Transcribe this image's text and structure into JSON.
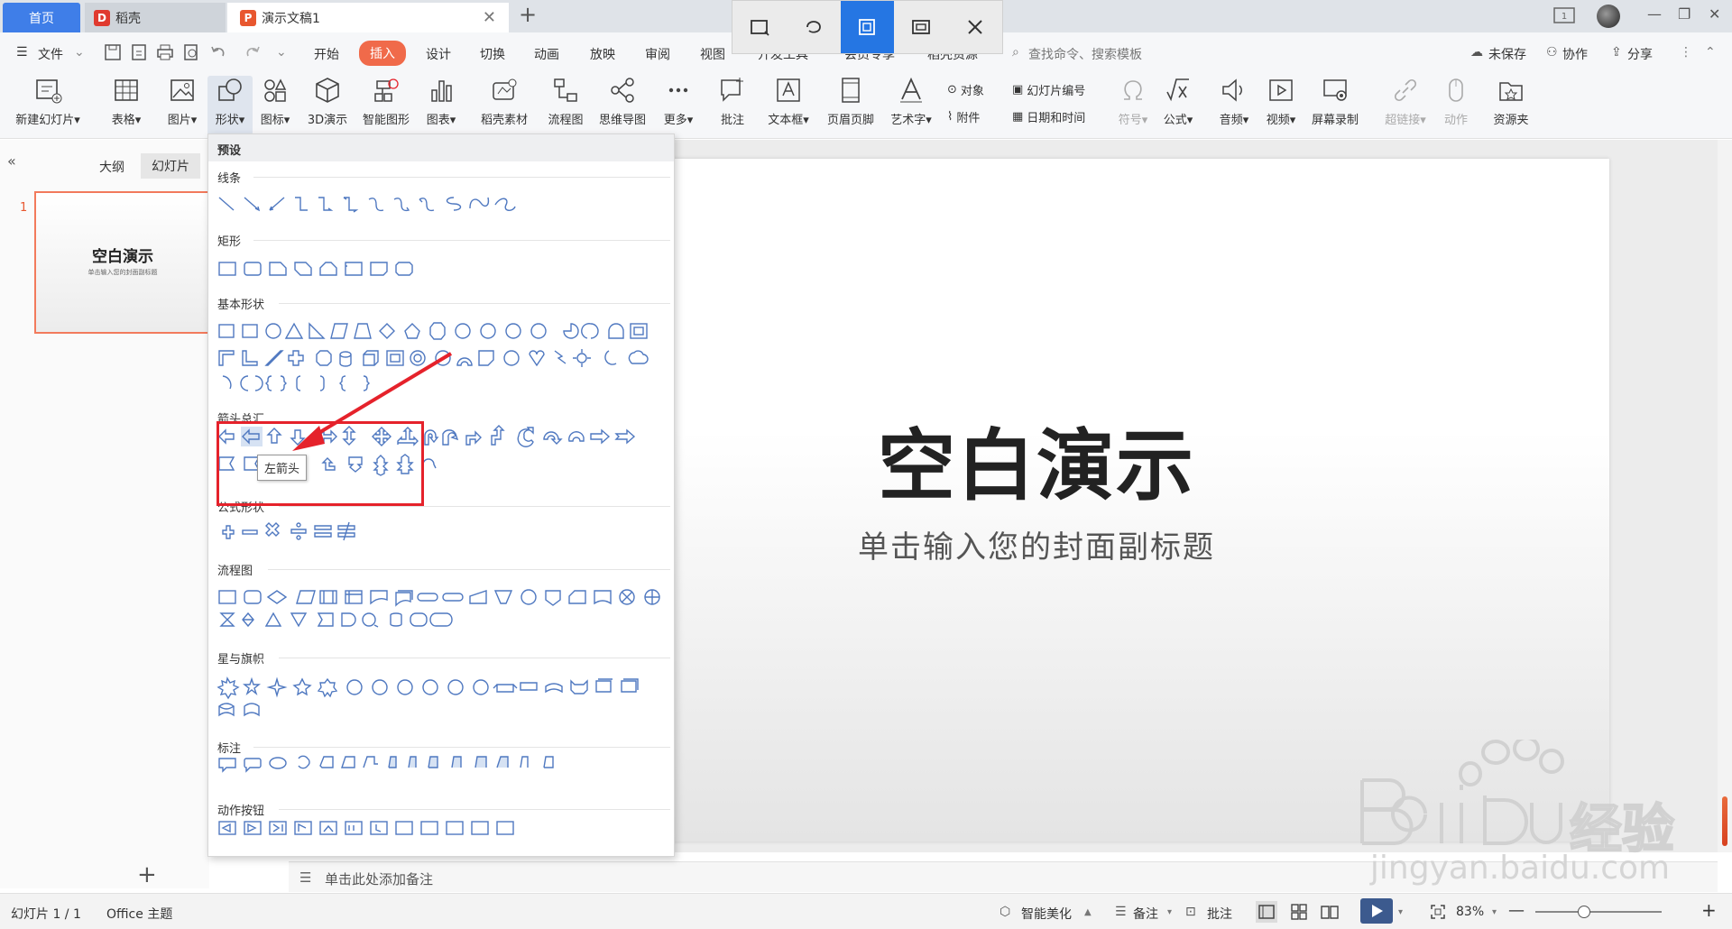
{
  "tabs": {
    "home": "首页",
    "daoke": "稻壳",
    "doc": "演示文稿1"
  },
  "menu": {
    "file": "文件",
    "items": [
      "开始",
      "插入",
      "设计",
      "切换",
      "动画",
      "放映",
      "审阅",
      "视图",
      "开发工具",
      "会员专享",
      "稻壳资源"
    ],
    "search_placeholder": "查找命令、搜索模板",
    "unsaved": "未保存",
    "collab": "协作",
    "share": "分享"
  },
  "ribbon": {
    "new_slide": "新建幻灯片",
    "table": "表格",
    "picture": "图片",
    "shape": "形状",
    "icon": "图标",
    "demo3d": "3D演示",
    "smart": "智能图形",
    "chart": "图表",
    "daoke_mat": "稻壳素材",
    "flow": "流程图",
    "mindmap": "思维导图",
    "more": "更多",
    "comment": "批注",
    "textbox": "文本框",
    "header_footer": "页眉页脚",
    "wordart": "艺术字",
    "object": "对象",
    "slide_num": "幻灯片编号",
    "attach": "附件",
    "datetime": "日期和时间",
    "symbol": "符号",
    "formula": "公式",
    "audio": "音频",
    "video": "视频",
    "screen_rec": "屏幕录制",
    "hyperlink": "超链接",
    "action": "动作",
    "resource": "资源夹"
  },
  "panel": {
    "outline": "大纲",
    "slides": "幻灯片",
    "slide_index": "1",
    "thumb_title": "空白演示",
    "thumb_sub": "单击输入您的封面副标题"
  },
  "slide": {
    "title": "空白演示",
    "subtitle": "单击输入您的封面副标题"
  },
  "notes": "单击此处添加备注",
  "dropdown": {
    "preset": "预设",
    "sections": [
      "线条",
      "矩形",
      "基本形状",
      "箭头总汇",
      "公式形状",
      "流程图",
      "星与旗帜",
      "标注",
      "动作按钮"
    ],
    "tooltip": "左箭头"
  },
  "status": {
    "slide_pos": "幻灯片 1 / 1",
    "theme": "Office 主题",
    "beautify": "智能美化",
    "notes": "备注",
    "comment": "批注",
    "zoom": "83%"
  },
  "watermark": "jingyan.baidu.com",
  "colors": {
    "accent_blue": "#3f7ee8",
    "insert_orange": "#f06a4a",
    "highlight_red": "#e5222b",
    "shape_blue": "#4f78c0"
  }
}
